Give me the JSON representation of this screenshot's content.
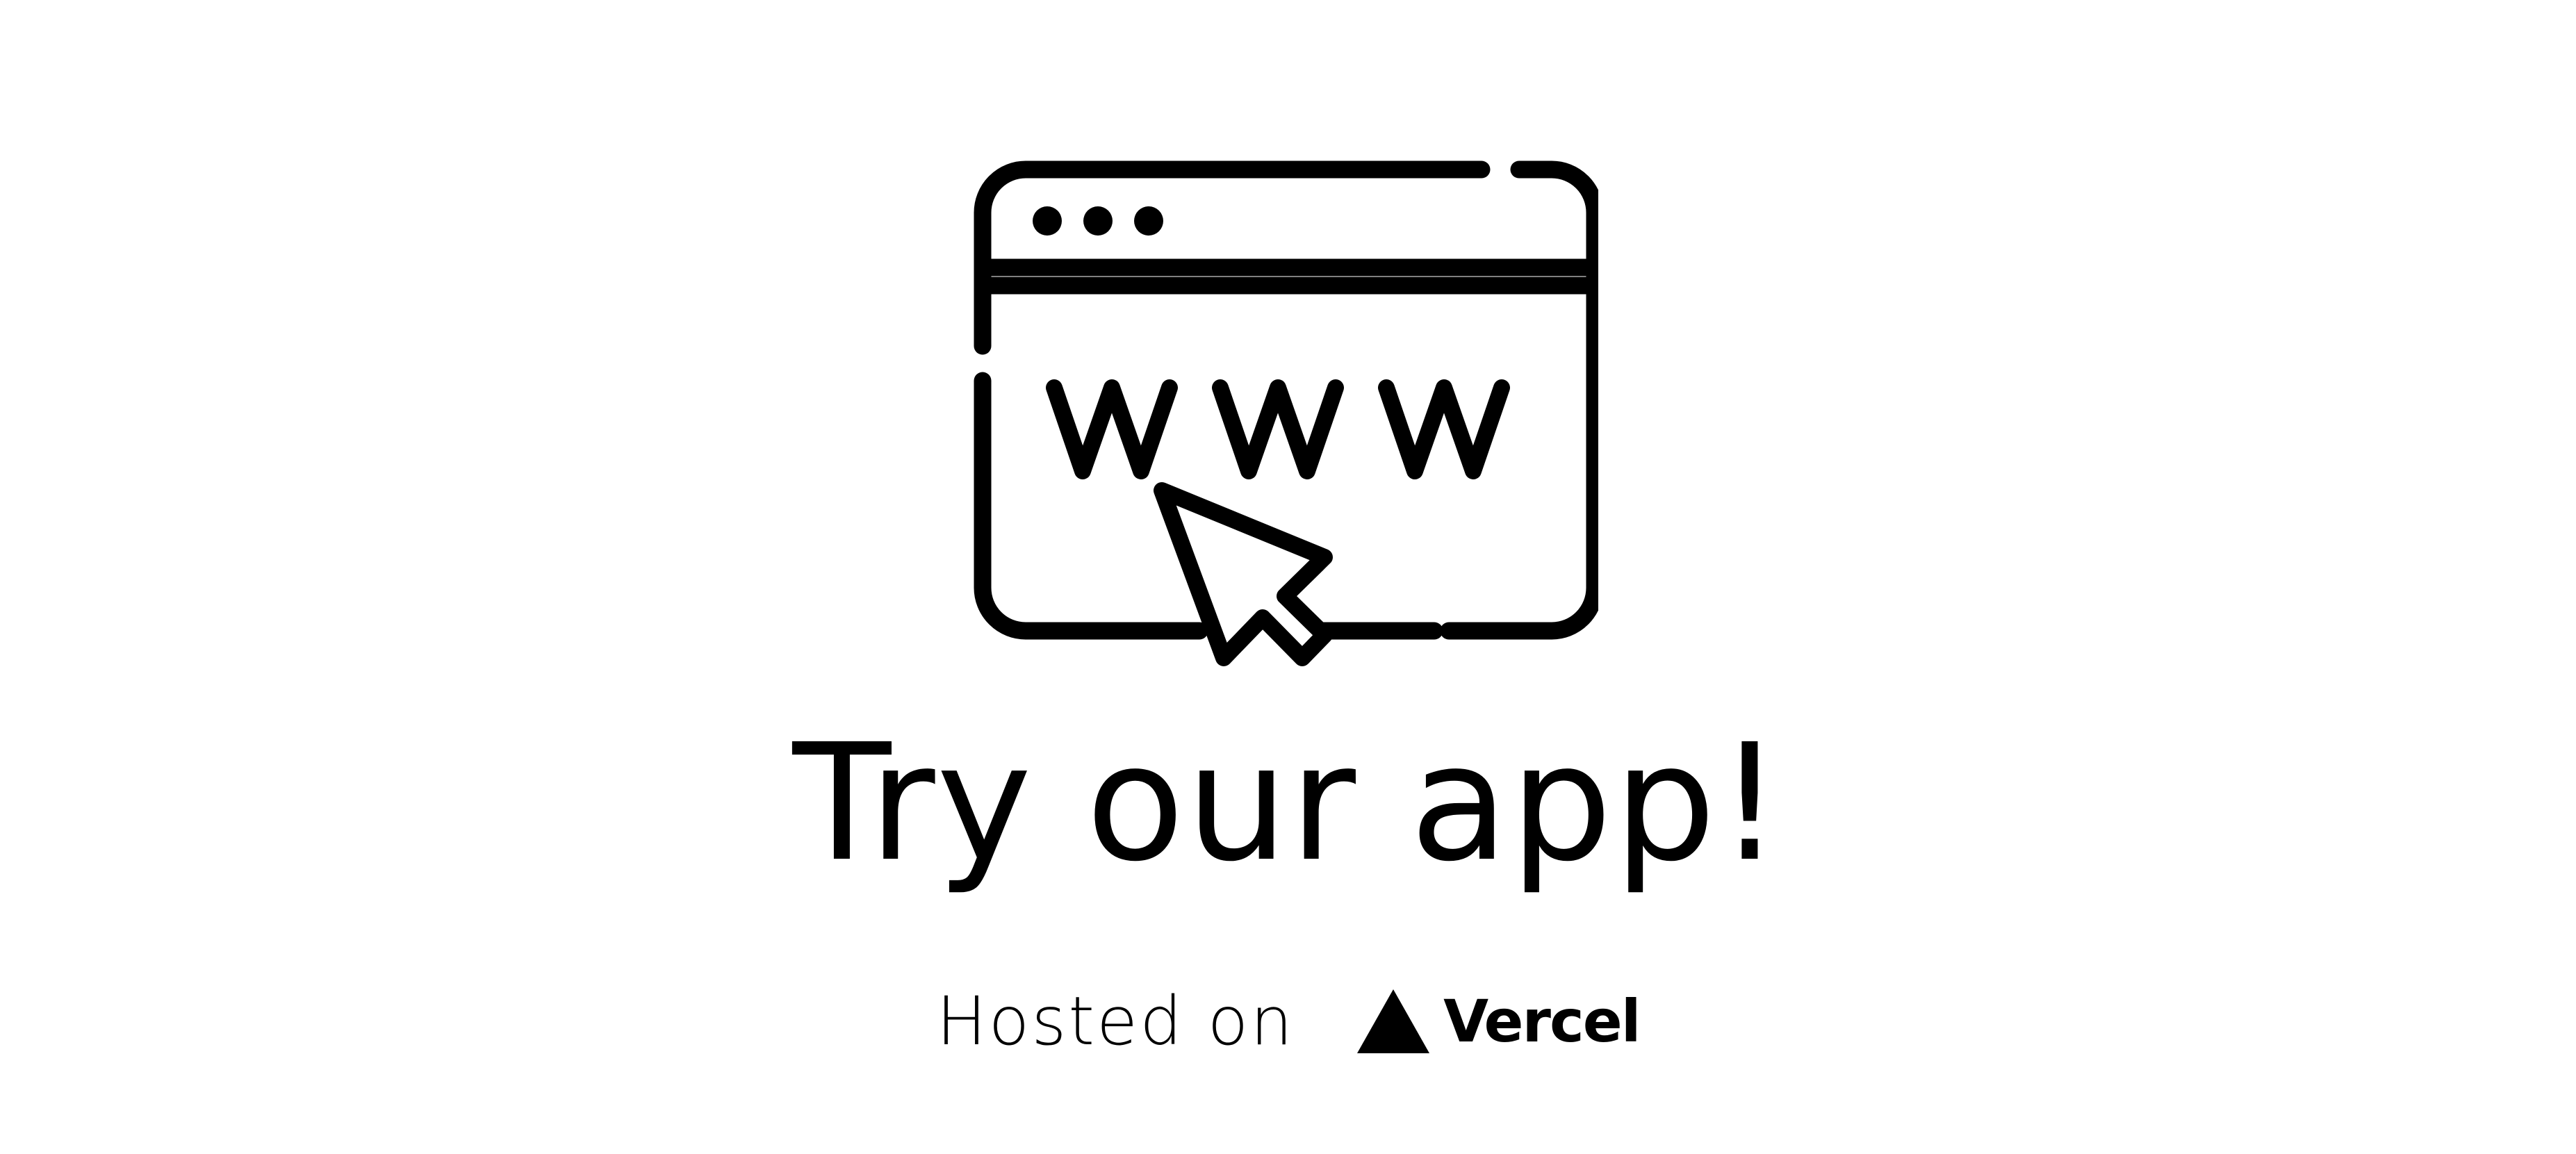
{
  "illustration": {
    "icon": "browser-window-www-cursor-icon",
    "text": "WWW"
  },
  "headline": "Try our app!",
  "hosted": {
    "label": "Hosted on",
    "provider": "Vercel",
    "provider_icon": "vercel-triangle-icon"
  },
  "colors": {
    "foreground": "#000000",
    "background": "#ffffff"
  }
}
